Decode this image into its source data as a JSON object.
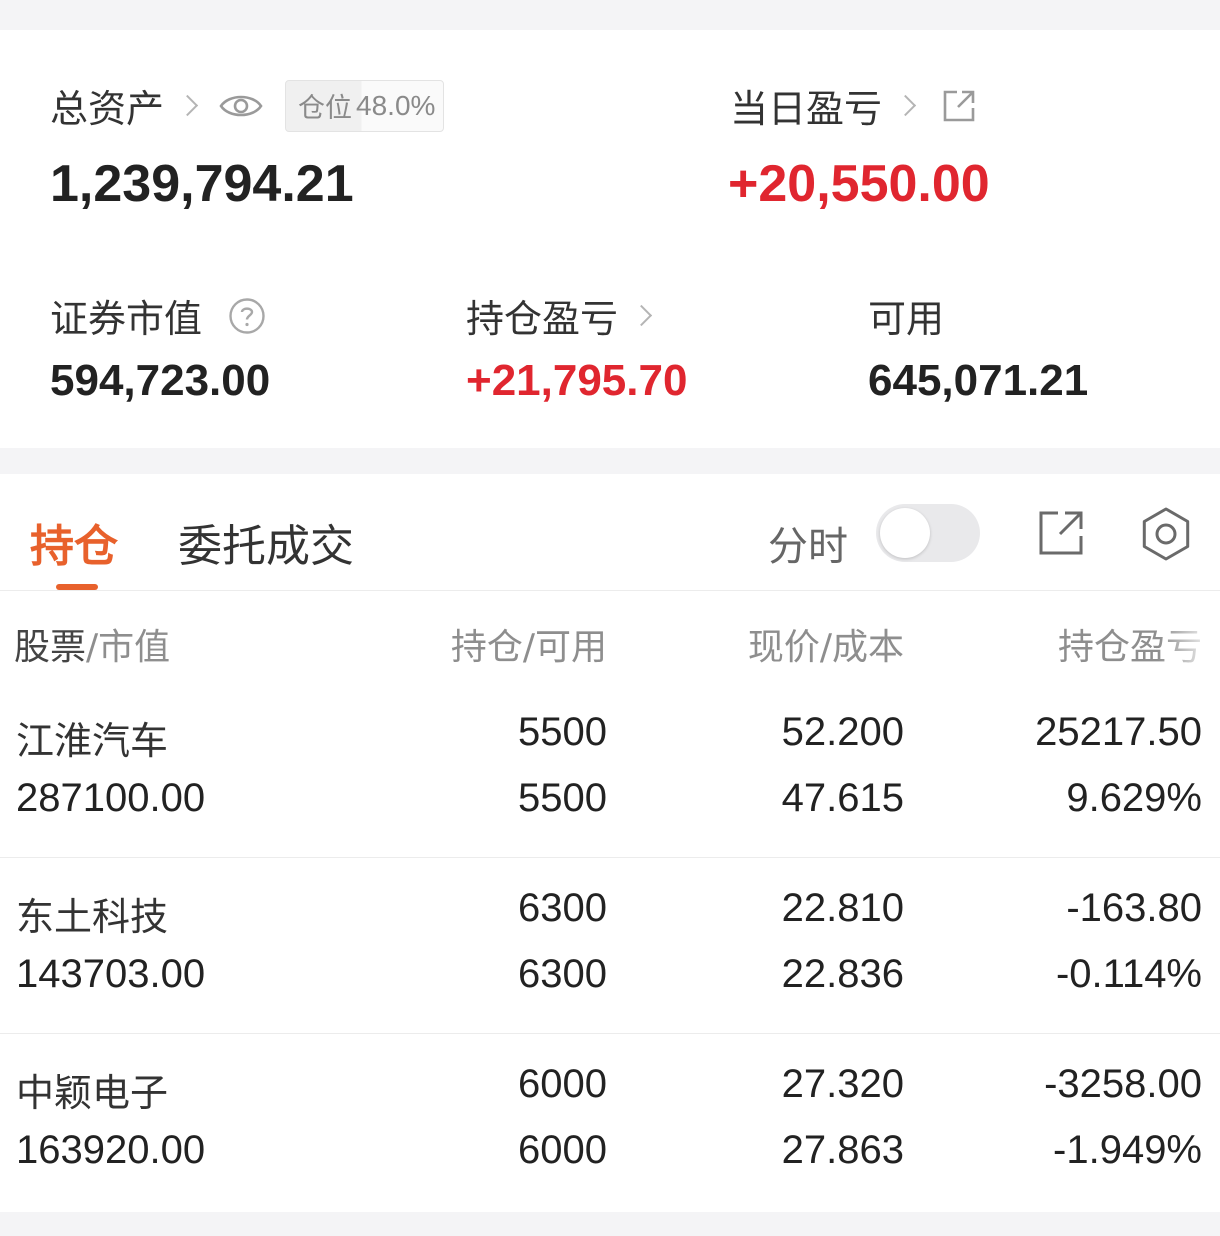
{
  "summary": {
    "total_assets_label": "总资产",
    "position_badge_label": "仓位",
    "position_badge_value": "48.0%",
    "total_assets_value": "1,239,794.21",
    "daily_pl_label": "当日盈亏",
    "daily_pl_value": "+20,550.00",
    "securities_value_label": "证券市值",
    "securities_value": "594,723.00",
    "holding_pl_label": "持仓盈亏",
    "holding_pl_value": "+21,795.70",
    "available_label": "可用",
    "available_value": "645,071.21"
  },
  "tabs": {
    "active": "持仓",
    "inactive": "委托成交",
    "fenshi_label": "分时"
  },
  "table": {
    "headers": {
      "stock": "股票",
      "market_value": "市值",
      "position": "持仓",
      "available": "可用",
      "price": "现价",
      "cost": "成本",
      "holding_pl": "持仓盈亏"
    },
    "rows": [
      {
        "name": "江淮汽车",
        "market_value": "287100.00",
        "position": "5500",
        "available": "5500",
        "price": "52.200",
        "cost": "47.615",
        "pl": "25217.50",
        "pl_pct": "9.629%",
        "trend": "up"
      },
      {
        "name": "东土科技",
        "market_value": "143703.00",
        "position": "6300",
        "available": "6300",
        "price": "22.810",
        "cost": "22.836",
        "pl": "-163.80",
        "pl_pct": "-0.114%",
        "trend": "down"
      },
      {
        "name": "中颖电子",
        "market_value": "163920.00",
        "position": "6000",
        "available": "6000",
        "price": "27.320",
        "cost": "27.863",
        "pl": "-3258.00",
        "pl_pct": "-1.949%",
        "trend": "down"
      }
    ]
  },
  "colors": {
    "gain": "#e0262f",
    "loss": "#43a12b",
    "accent": "#e8612c"
  },
  "icons": [
    "chevron-right-icon",
    "eye-icon",
    "share-icon",
    "help-circle-icon",
    "gear-icon"
  ]
}
